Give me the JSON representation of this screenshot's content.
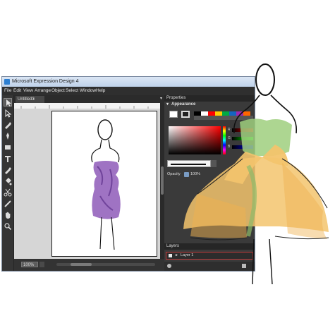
{
  "window": {
    "title": "Microsoft Expression Design 4"
  },
  "menu": [
    "File",
    "Edit",
    "View",
    "Arrange",
    "Object",
    "Select",
    "Window",
    "Help"
  ],
  "document": {
    "tab_label": "Untitled1",
    "tab_close": "×"
  },
  "toolbox": {
    "tools": [
      "selection-tool-icon",
      "direct-selection-tool-icon",
      "pen-tool-icon",
      "brush-tool-icon",
      "rectangle-tool-icon",
      "text-tool-icon",
      "eyedropper-tool-icon",
      "paint-bucket-tool-icon",
      "scissors-tool-icon",
      "gradient-tool-icon",
      "hand-tool-icon",
      "zoom-tool-icon"
    ]
  },
  "status": {
    "zoom": "100%"
  },
  "properties": {
    "header": "Properties",
    "appearance_label": "Appearance",
    "rgb_labels": [
      "R",
      "G",
      "B"
    ],
    "opacity_label": "Opacity",
    "opacity_value": "100%"
  },
  "layers": {
    "header": "Layers",
    "items": [
      {
        "name": "Layer 1",
        "arrow": "►"
      }
    ]
  },
  "colors": {
    "swatches": [
      "#000000",
      "#ffffff",
      "#ff0000",
      "#ffcc00",
      "#00aa44",
      "#1565c0",
      "#9c27b0",
      "#ff6600"
    ],
    "dress_purple": "#8e5bb8",
    "dress_yellow": "#f3c46d",
    "dress_green": "#9fcf7e",
    "layer_highlight": "#c23b3b"
  }
}
